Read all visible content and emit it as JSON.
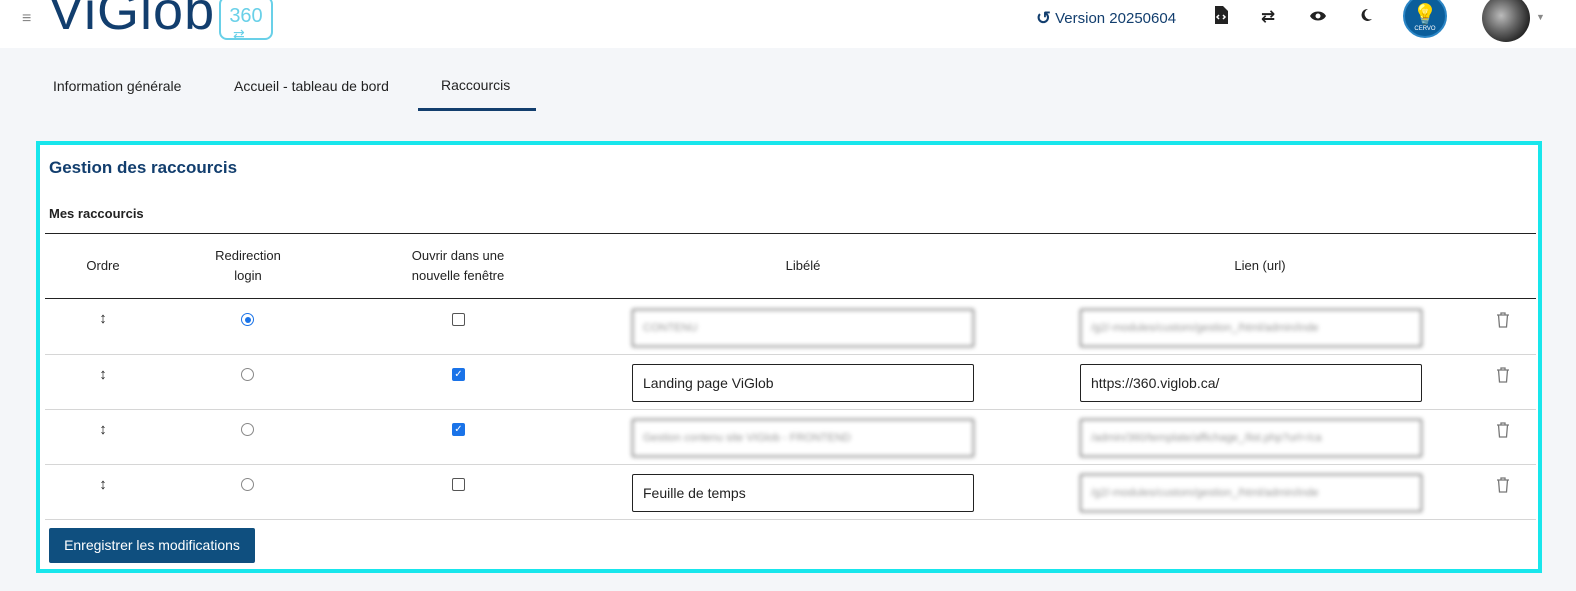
{
  "header": {
    "menu_icon": "hamburger-icon",
    "logo_text": "ViGlob",
    "logo_badge": "360",
    "version_icon": "history-icon",
    "version_label": "Version 20250604",
    "icons": [
      "file-code-icon",
      "swap-icon",
      "eye-icon",
      "moon-icon"
    ],
    "bulb_text": "CERVO",
    "accent_color": "#123e6e",
    "badge_color": "#69d0e8"
  },
  "tabs": [
    {
      "label": "Information générale",
      "active": false
    },
    {
      "label": "Accueil - tableau de bord",
      "active": false
    },
    {
      "label": "Raccourcis",
      "active": true
    }
  ],
  "panel": {
    "title": "Gestion des raccourcis",
    "section_title": "Mes raccourcis",
    "border_color": "#18e6ec"
  },
  "table": {
    "headers": {
      "order": "Ordre",
      "redirect_line1": "Redirection",
      "redirect_line2": "login",
      "newwin_line1": "Ouvrir dans une",
      "newwin_line2": "nouvelle fenêtre",
      "label": "Libélé",
      "link": "Lien (url)"
    },
    "rows": [
      {
        "redirect_login": true,
        "new_window": false,
        "label": "CONTENU",
        "url": "/g2/-modules/custom/gestion_/html/admin/inde",
        "label_blurred": true,
        "url_blurred": true
      },
      {
        "redirect_login": false,
        "new_window": true,
        "label": "Landing page ViGlob",
        "url": "https://360.viglob.ca/",
        "label_blurred": false,
        "url_blurred": false
      },
      {
        "redirect_login": false,
        "new_window": true,
        "label": "Gestion contenu site VIGlob - FRONTEND",
        "url": "/admin/360/template/affichage_/list.php?url=/ca",
        "label_blurred": true,
        "url_blurred": true
      },
      {
        "redirect_login": false,
        "new_window": false,
        "label": "Feuille de temps",
        "url": "/g2/-modules/custom/gestion_/html/admin/inde",
        "label_blurred": false,
        "url_blurred": true
      }
    ]
  },
  "actions": {
    "save_label": "Enregistrer les modifications"
  }
}
